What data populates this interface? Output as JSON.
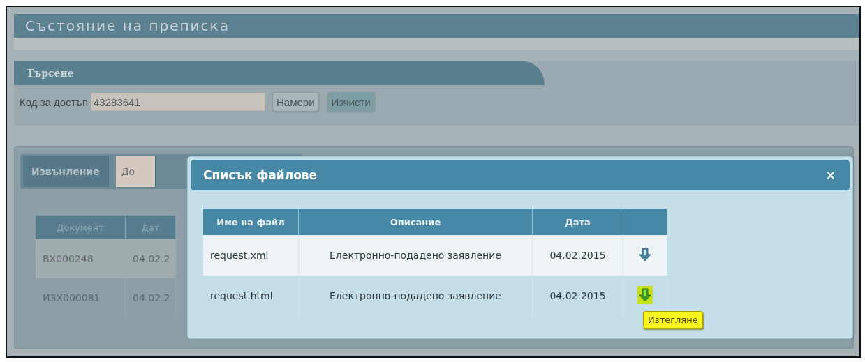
{
  "page_title": "Състояние на преписка",
  "search": {
    "title": "Търсене",
    "label": "Код за достъп",
    "value": "43283641",
    "buttons": [
      "Намери",
      "Изчисти"
    ]
  },
  "tabs": [
    {
      "label": "Извънление",
      "selected": true
    },
    {
      "label": "До",
      "selected": false
    }
  ],
  "documents": {
    "columns": [
      "Документ",
      "Дат"
    ],
    "rows": [
      [
        "ВХ000248",
        "04.02.2"
      ],
      [
        "ИЗХ000081",
        "04.02.2"
      ]
    ]
  },
  "dialog": {
    "title": "Списък файлове",
    "close": "×",
    "columns": [
      "Име на файл",
      "Описание",
      "Дата",
      ""
    ],
    "files": [
      {
        "name": "request.xml",
        "description": "Електронно-подадено заявление",
        "date": "04.02.2015",
        "highlighted": false
      },
      {
        "name": "request.html",
        "description": "Електронно-подадено заявление",
        "date": "04.02.2015",
        "highlighted": true,
        "tooltip": "Изтегляне"
      }
    ]
  }
}
